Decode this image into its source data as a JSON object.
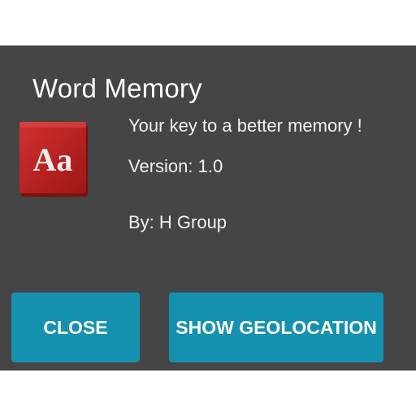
{
  "dialog": {
    "title": "Word Memory",
    "tagline": "Your key to a better memory !",
    "version": "Version: 1.0",
    "author": "By: H Group",
    "icon": {
      "name": "book-aa-icon",
      "text": "Aa",
      "color": "#b81f1f"
    },
    "buttons": {
      "close": "CLOSE",
      "show_geolocation": "SHOW GEOLOCATION"
    },
    "colors": {
      "background": "#454545",
      "button": "#1591b0"
    }
  }
}
